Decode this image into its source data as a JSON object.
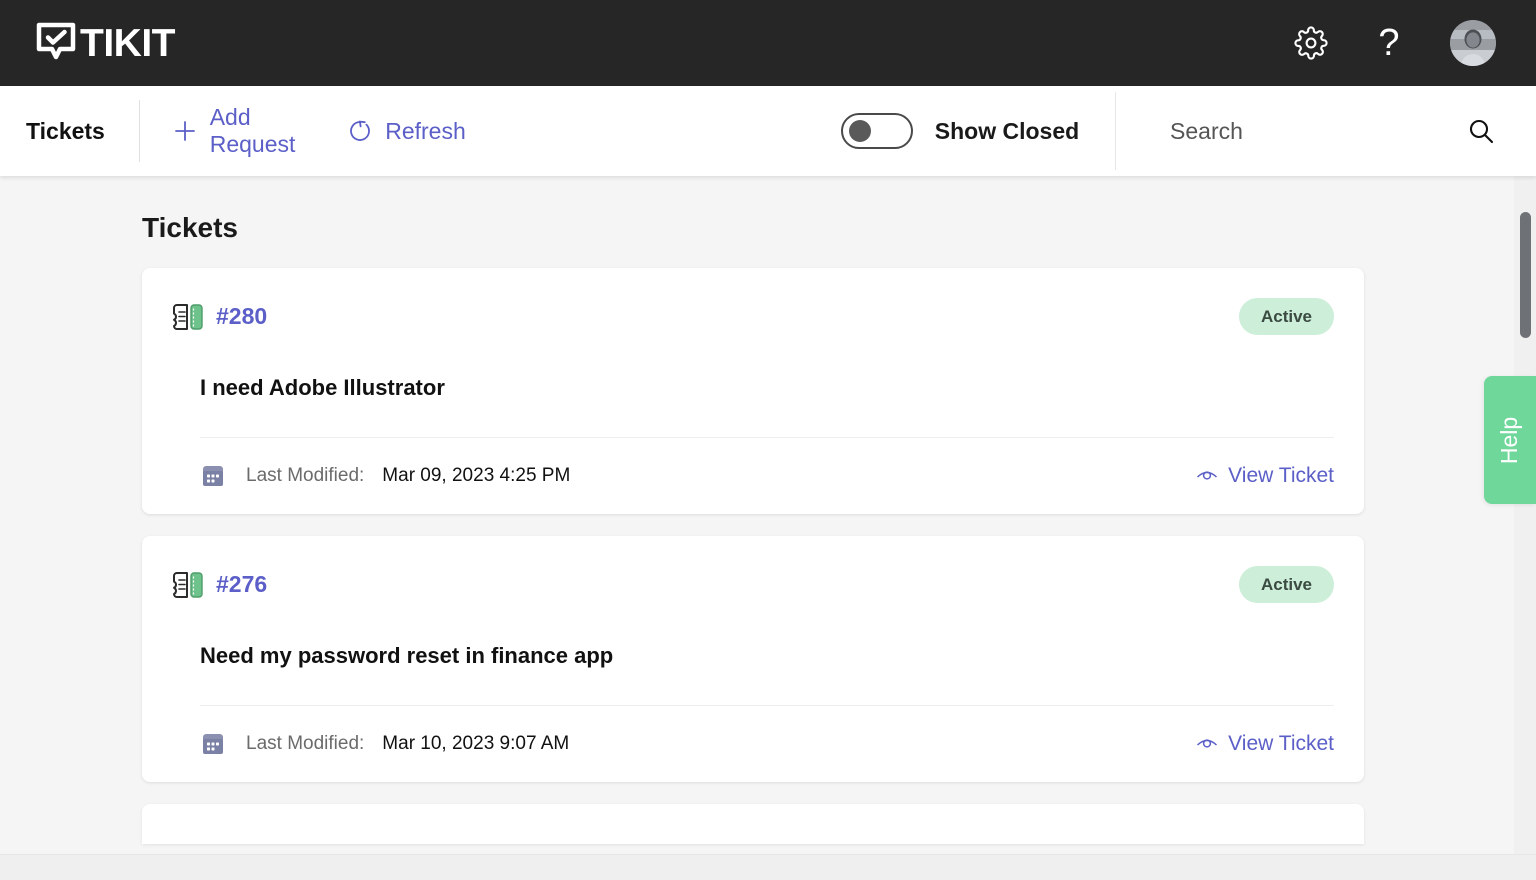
{
  "header": {
    "logo_text": "TIKIT",
    "logo_icon": "checkmark-speech-bubble-icon",
    "settings_icon": "gear-icon",
    "help_icon": "question-mark-icon",
    "help_glyph": "?",
    "avatar_icon": "user-avatar"
  },
  "toolbar": {
    "title": "Tickets",
    "add_request_label": "Add Request",
    "add_request_icon": "plus-icon",
    "refresh_label": "Refresh",
    "refresh_icon": "refresh-icon",
    "toggle_label": "Show Closed",
    "toggle_state": "off",
    "search_placeholder": "Search",
    "search_value": "",
    "search_icon": "search-icon"
  },
  "main": {
    "page_title": "Tickets",
    "tickets": [
      {
        "id": "#280",
        "icon": "ticket-icon",
        "status": "Active",
        "subject": "I need Adobe Illustrator",
        "last_modified_label": "Last Modified:",
        "last_modified_value": "Mar 09, 2023 4:25 PM",
        "calendar_icon": "calendar-icon",
        "view_label": "View Ticket",
        "view_icon": "eye-icon"
      },
      {
        "id": "#276",
        "icon": "ticket-icon",
        "status": "Active",
        "subject": "Need my password reset in finance app",
        "last_modified_label": "Last Modified:",
        "last_modified_value": "Mar 10, 2023 9:07 AM",
        "calendar_icon": "calendar-icon",
        "view_label": "View Ticket",
        "view_icon": "eye-icon"
      }
    ]
  },
  "help_tab": {
    "label": "Help"
  },
  "colors": {
    "header_bg": "#262626",
    "accent_purple": "#5b5fc7",
    "badge_bg": "#cdeed8",
    "badge_text": "#3b4b42",
    "help_green": "#6fd79a",
    "body_bg": "#f5f5f5",
    "card_bg": "#ffffff"
  }
}
